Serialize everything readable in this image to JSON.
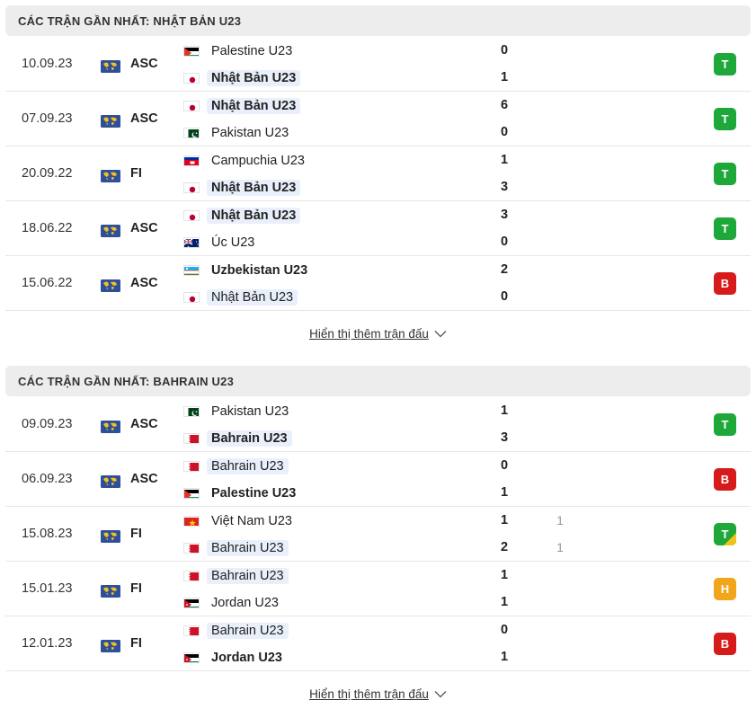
{
  "sections": [
    {
      "title": "CÁC TRẬN GẦN NHẤT: NHẬT BẢN U23",
      "show_more": "Hiển thị thêm trận đấu",
      "matches": [
        {
          "date": "10.09.23",
          "league": "ASC",
          "home": {
            "name": "Palestine U23",
            "flag": "palestine",
            "score": "0",
            "highlight": false,
            "bold": false
          },
          "away": {
            "name": "Nhật Bản U23",
            "flag": "japan",
            "score": "1",
            "highlight": true,
            "bold": true
          },
          "result": "T",
          "result_type": "w"
        },
        {
          "date": "07.09.23",
          "league": "ASC",
          "home": {
            "name": "Nhật Bản U23",
            "flag": "japan",
            "score": "6",
            "highlight": true,
            "bold": true
          },
          "away": {
            "name": "Pakistan U23",
            "flag": "pakistan",
            "score": "0",
            "highlight": false,
            "bold": false
          },
          "result": "T",
          "result_type": "w"
        },
        {
          "date": "20.09.22",
          "league": "FI",
          "home": {
            "name": "Campuchia U23",
            "flag": "cambodia",
            "score": "1",
            "highlight": false,
            "bold": false
          },
          "away": {
            "name": "Nhật Bản U23",
            "flag": "japan",
            "score": "3",
            "highlight": true,
            "bold": true
          },
          "result": "T",
          "result_type": "w"
        },
        {
          "date": "18.06.22",
          "league": "ASC",
          "home": {
            "name": "Nhật Bản U23",
            "flag": "japan",
            "score": "3",
            "highlight": true,
            "bold": true
          },
          "away": {
            "name": "Úc U23",
            "flag": "australia",
            "score": "0",
            "highlight": false,
            "bold": false
          },
          "result": "T",
          "result_type": "w"
        },
        {
          "date": "15.06.22",
          "league": "ASC",
          "home": {
            "name": "Uzbekistan U23",
            "flag": "uzbekistan",
            "score": "2",
            "highlight": false,
            "bold": true
          },
          "away": {
            "name": "Nhật Bản U23",
            "flag": "japan",
            "score": "0",
            "highlight": true,
            "bold": false
          },
          "result": "B",
          "result_type": "l"
        }
      ]
    },
    {
      "title": "CÁC TRẬN GẦN NHẤT: BAHRAIN U23",
      "show_more": "Hiển thị thêm trận đấu",
      "matches": [
        {
          "date": "09.09.23",
          "league": "ASC",
          "home": {
            "name": "Pakistan U23",
            "flag": "pakistan",
            "score": "1",
            "highlight": false,
            "bold": false
          },
          "away": {
            "name": "Bahrain U23",
            "flag": "bahrain",
            "score": "3",
            "highlight": true,
            "bold": true
          },
          "result": "T",
          "result_type": "w"
        },
        {
          "date": "06.09.23",
          "league": "ASC",
          "home": {
            "name": "Bahrain U23",
            "flag": "bahrain",
            "score": "0",
            "highlight": true,
            "bold": false
          },
          "away": {
            "name": "Palestine U23",
            "flag": "palestine",
            "score": "1",
            "highlight": false,
            "bold": true
          },
          "result": "B",
          "result_type": "l"
        },
        {
          "date": "15.08.23",
          "league": "FI",
          "home": {
            "name": "Việt Nam U23",
            "flag": "vietnam",
            "score": "1",
            "pen": "1",
            "highlight": false,
            "bold": false
          },
          "away": {
            "name": "Bahrain U23",
            "flag": "bahrain",
            "score": "2",
            "pen": "1",
            "highlight": true,
            "bold": false
          },
          "result": "T",
          "result_type": "w",
          "result_corner": true
        },
        {
          "date": "15.01.23",
          "league": "FI",
          "home": {
            "name": "Bahrain U23",
            "flag": "bahrain",
            "score": "1",
            "highlight": true,
            "bold": false
          },
          "away": {
            "name": "Jordan U23",
            "flag": "jordan",
            "score": "1",
            "highlight": false,
            "bold": false
          },
          "result": "H",
          "result_type": "d"
        },
        {
          "date": "12.01.23",
          "league": "FI",
          "home": {
            "name": "Bahrain U23",
            "flag": "bahrain",
            "score": "0",
            "highlight": true,
            "bold": false
          },
          "away": {
            "name": "Jordan U23",
            "flag": "jordan",
            "score": "1",
            "highlight": false,
            "bold": true
          },
          "result": "B",
          "result_type": "l"
        }
      ]
    }
  ],
  "colors": {
    "win": "#1ea83a",
    "loss": "#d71b1b",
    "draw": "#f2a41b",
    "highlight": "#e9f0fb",
    "header_bg": "#ededed"
  },
  "icons": {
    "league": "world-map-icon",
    "expand": "chevron-down-icon"
  }
}
